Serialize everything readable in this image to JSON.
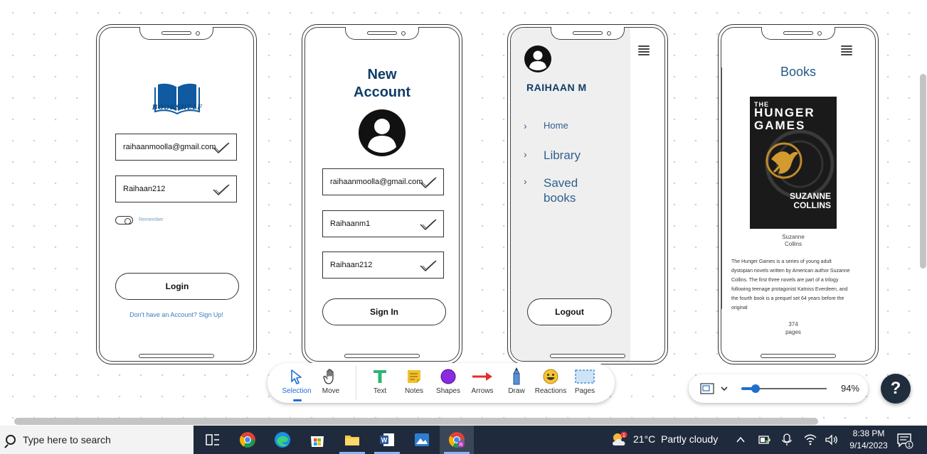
{
  "phone1": {
    "logo_text": "BOOKSHELF",
    "email_value": "raihaanmoolla@gmail.com",
    "password_value": "Raihaan212",
    "remember_label": "Remember",
    "login_label": "Login",
    "signup_link": "Don't have an Account? Sign Up!"
  },
  "phone2": {
    "title_line1": "New",
    "title_line2": "Account",
    "email_value": "raihaanmoolla@gmail.com",
    "username_value": "Raihaanm1",
    "password_value": "Raihaan212",
    "signin_label": "Sign In"
  },
  "phone3": {
    "username": "RAIHAAN M",
    "nav": [
      {
        "label": "Home"
      },
      {
        "label": "Library"
      },
      {
        "label": "Saved books"
      }
    ],
    "logout_label": "Logout"
  },
  "phone4": {
    "title": "Books",
    "cover_line1": "THE",
    "cover_line2": "HUNGER",
    "cover_line3": "GAMES",
    "cover_author1": "SUZANNE",
    "cover_author2": "COLLINS",
    "author": "Suzanne Collins",
    "description": "The Hunger Games is a series of young adult dystopian novels written by American author Suzanne Collins. The first three novels are part of a trilogy following teenage protagonist Katniss Everdeen, and the fourth book is a prequel set 64 years before the original",
    "pages_count": "374",
    "pages_label": "pages"
  },
  "toolbar": {
    "tools": [
      {
        "label": "Selection",
        "icon": "cursor-arrow-icon"
      },
      {
        "label": "Move",
        "icon": "hand-icon"
      },
      {
        "label": "Text",
        "icon": "text-t-icon"
      },
      {
        "label": "Notes",
        "icon": "sticky-note-icon"
      },
      {
        "label": "Shapes",
        "icon": "circle-shape-icon"
      },
      {
        "label": "Arrows",
        "icon": "arrow-icon"
      },
      {
        "label": "Draw",
        "icon": "pencil-icon"
      },
      {
        "label": "Reactions",
        "icon": "smiley-icon"
      },
      {
        "label": "Pages",
        "icon": "pages-frame-icon"
      }
    ],
    "active_tool": "Selection"
  },
  "zoom": {
    "value": "94%",
    "level": 0.17
  },
  "help_label": "?",
  "taskbar": {
    "search_placeholder": "Type here to search",
    "weather_temp": "21°C",
    "weather_desc": "Partly cloudy",
    "weather_badge": "1",
    "time": "8:38 PM",
    "date": "9/14/2023",
    "notification_count": "1"
  }
}
